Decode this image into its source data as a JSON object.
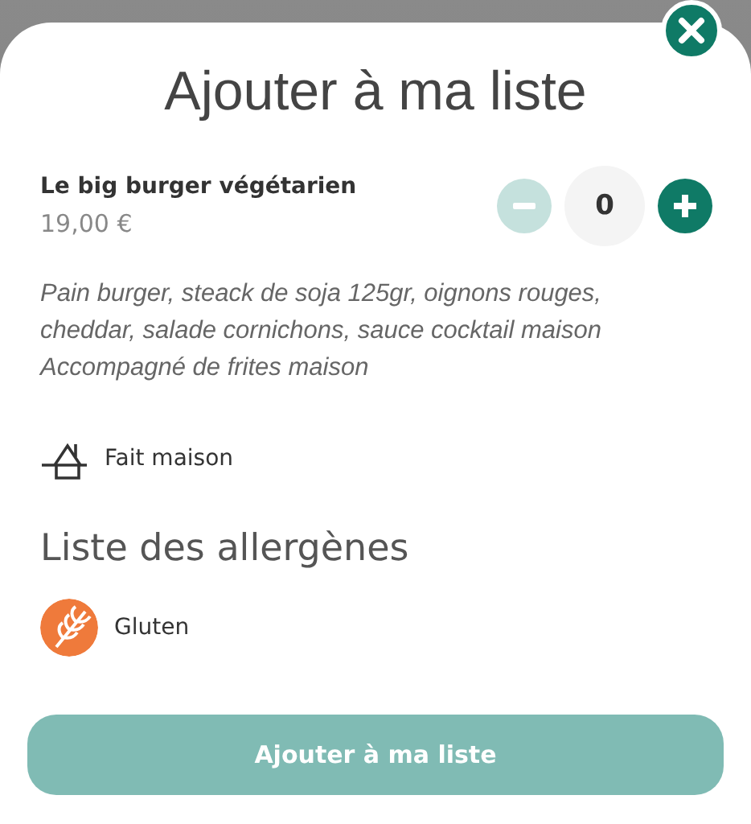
{
  "title": "Ajouter à ma liste",
  "product": {
    "name": "Le big burger végétarien",
    "price": "19,00 €",
    "quantity": "0",
    "decrease_disabled": true,
    "increase_disabled": false
  },
  "description": [
    "Pain burger, steack de soja 125gr, oignons rouges,",
    "cheddar, salade cornichons, sauce cocktail maison",
    "Accompagné de frites maison"
  ],
  "features": [
    {
      "kind": "homemade",
      "label": "Fait maison"
    }
  ],
  "allergens_heading": "Liste des allergènes",
  "allergens": [
    {
      "kind": "gluten",
      "label": "Gluten",
      "color": "#ef7a3b"
    }
  ],
  "submit": {
    "label": "Ajouter à ma liste",
    "disabled": true
  }
}
